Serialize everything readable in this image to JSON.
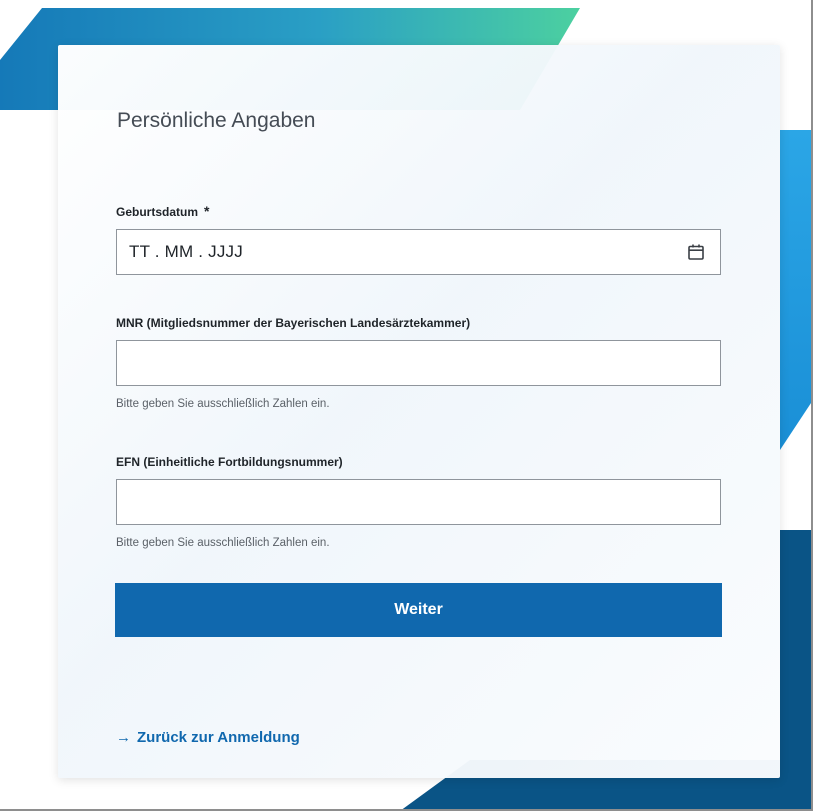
{
  "card": {
    "title": "Persönliche Angaben"
  },
  "fields": {
    "birthdate": {
      "label": "Geburtsdatum",
      "required_mark": "*",
      "value": "TT . MM . JJJJ",
      "icon": "calendar-icon"
    },
    "mnr": {
      "label": "MNR (Mitgliedsnummer der Bayerischen Landesärztekammer)",
      "value": "",
      "hint": "Bitte geben Sie ausschließlich Zahlen ein."
    },
    "efn": {
      "label": "EFN (Einheitliche Fortbildungsnummer)",
      "value": "",
      "hint": "Bitte geben Sie ausschließlich Zahlen ein."
    }
  },
  "actions": {
    "submit_label": "Weiter",
    "back_label": "Zurück zur Anmeldung",
    "back_icon": "arrow-right-icon"
  },
  "colors": {
    "primary": "#1068ae",
    "teal": "#48c8a4",
    "light_blue": "#26a4e2",
    "dark_blue": "#0a5486"
  }
}
